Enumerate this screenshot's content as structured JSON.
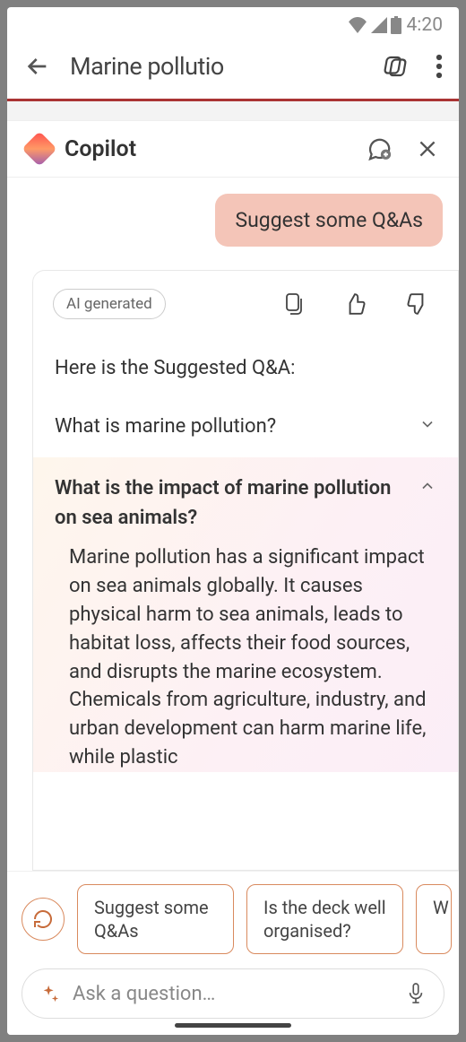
{
  "status": {
    "time": "4:20"
  },
  "header": {
    "title": "Marine pollutio"
  },
  "copilot": {
    "title": "Copilot"
  },
  "chat": {
    "user_message": "Suggest some Q&As",
    "ai_badge": "AI generated",
    "intro": "Here is the Suggested Q&A:",
    "qa": [
      {
        "question": "What is marine pollution?",
        "expanded": false
      },
      {
        "question": "What is the impact of marine pollution on sea animals?",
        "expanded": true,
        "answer": "Marine pollution has a significant impact on sea animals globally. It causes physical harm to sea animals, leads to habitat loss, affects their food sources, and disrupts the marine ecosystem. Chemicals from agriculture, industry, and urban development can harm marine life, while plastic"
      }
    ]
  },
  "suggestions": {
    "items": [
      "Suggest some Q&As",
      "Is the deck well organised?",
      "W\nth"
    ]
  },
  "input": {
    "placeholder": "Ask a question…"
  }
}
